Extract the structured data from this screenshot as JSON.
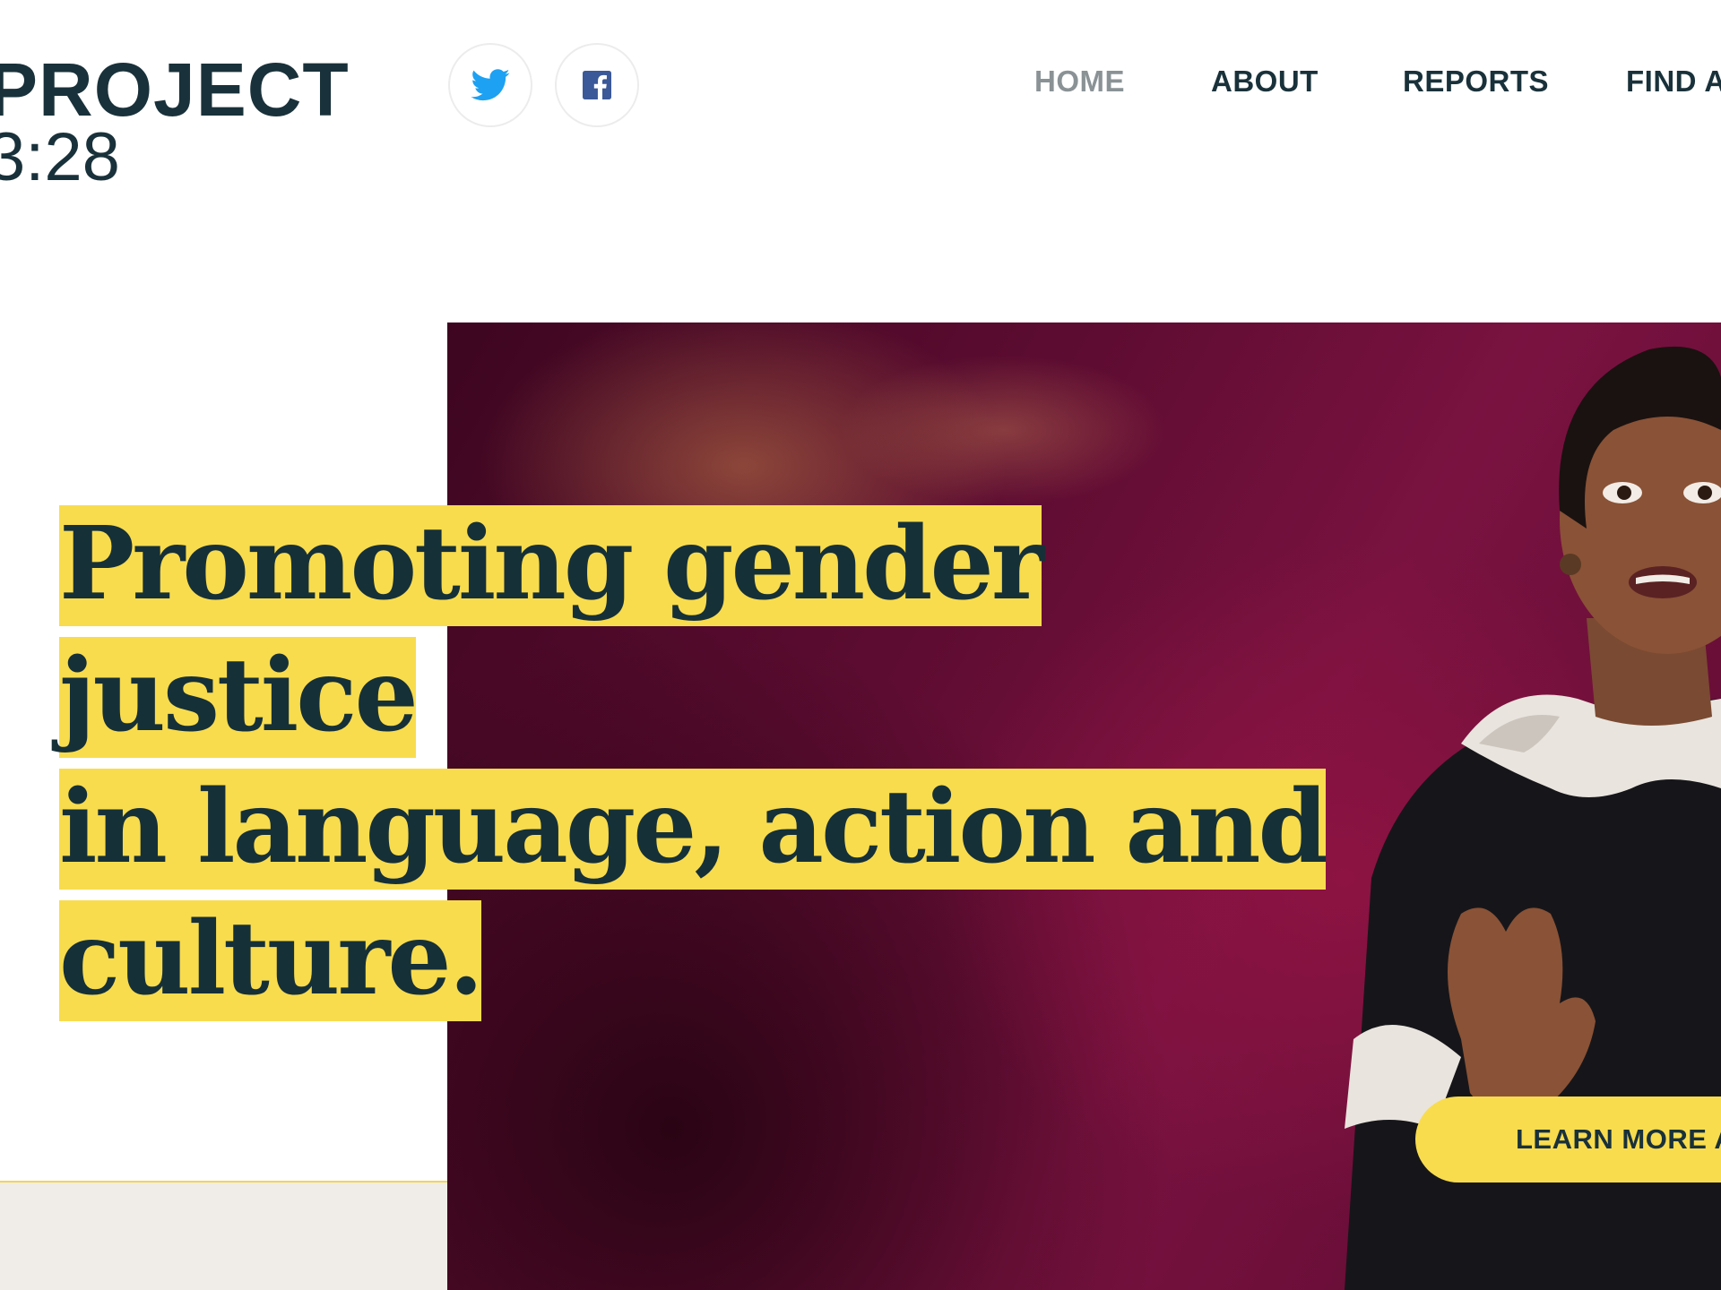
{
  "header": {
    "logo": {
      "line1": "PROJECT",
      "line2": "3:28"
    },
    "social": [
      {
        "name": "twitter",
        "icon": "twitter-icon",
        "color": "#1da1f2"
      },
      {
        "name": "facebook",
        "icon": "facebook-icon",
        "color": "#3b5998"
      }
    ],
    "nav": {
      "items": [
        {
          "label": "HOME",
          "active": true
        },
        {
          "label": "ABOUT",
          "active": false
        },
        {
          "label": "REPORTS",
          "active": false
        },
        {
          "label": "FIND A",
          "active": false
        }
      ]
    }
  },
  "hero": {
    "headline_line1": "Promoting gender justice",
    "headline_line2": "in language, action and",
    "headline_line3": "culture.",
    "cta_label": "LEARN MORE A"
  },
  "colors": {
    "brand_dark": "#19313a",
    "accent_yellow": "#f8dc4e",
    "nav_active": "#8a9296",
    "hero_magenta": "#7a1240",
    "band_beige": "#f0ede8"
  }
}
